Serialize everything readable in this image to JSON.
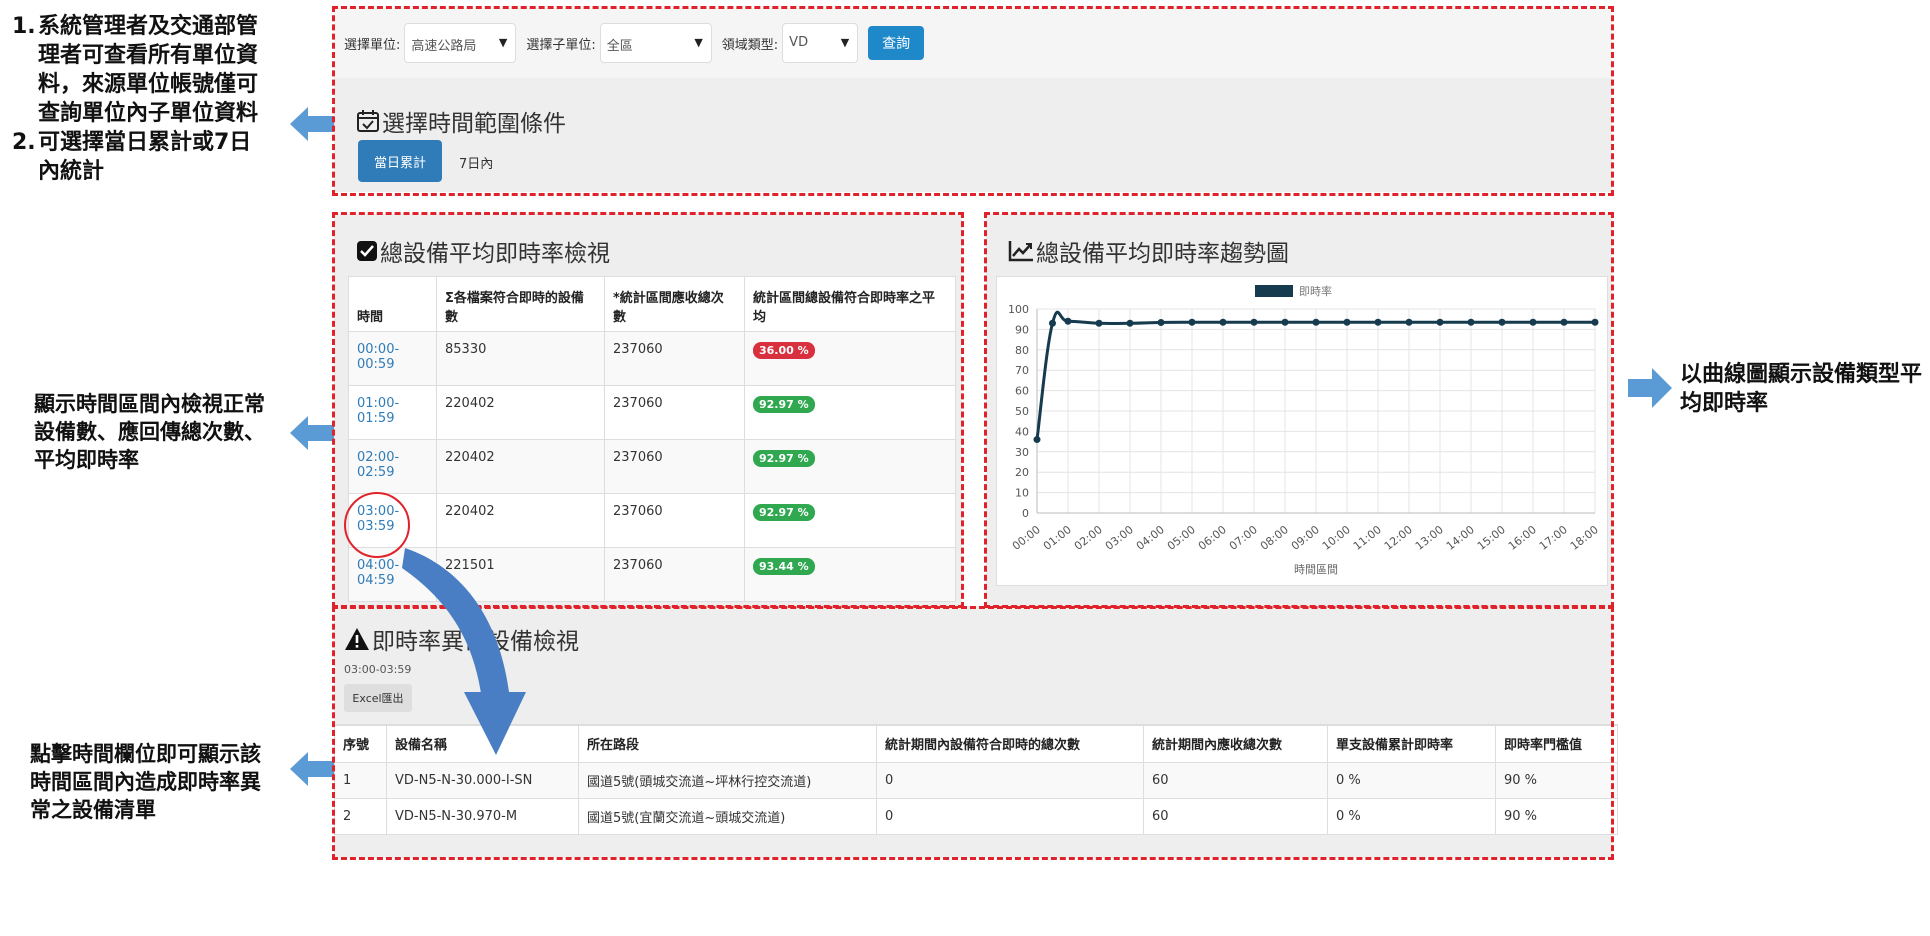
{
  "filters": {
    "unit_label": "選擇單位:",
    "unit_value": "高速公路局",
    "subunit_label": "選擇子單位:",
    "subunit_value": "全區",
    "domain_label": "領域類型:",
    "domain_value": "VD",
    "query_label": "查詢"
  },
  "time_range": {
    "title": "選擇時間範圍條件",
    "tab_today": "當日累計",
    "tab_7days": "7日內"
  },
  "summary": {
    "title": "總設備平均即時率檢視",
    "columns": [
      "時間",
      "Σ各檔案符合即時的設備數",
      "*統計區間應收總次數",
      "統計區間總設備符合即時率之平均"
    ],
    "rows": [
      {
        "time": "00:00-00:59",
        "devices": "85330",
        "total": "237060",
        "rate": "36.00 %",
        "status": "bad"
      },
      {
        "time": "01:00-01:59",
        "devices": "220402",
        "total": "237060",
        "rate": "92.97 %",
        "status": "good"
      },
      {
        "time": "02:00-02:59",
        "devices": "220402",
        "total": "237060",
        "rate": "92.97 %",
        "status": "good"
      },
      {
        "time": "03:00-03:59",
        "devices": "220402",
        "total": "237060",
        "rate": "92.97 %",
        "status": "good"
      },
      {
        "time": "04:00-04:59",
        "devices": "221501",
        "total": "237060",
        "rate": "93.44 %",
        "status": "good"
      }
    ]
  },
  "trend": {
    "title": "總設備平均即時率趨勢圖"
  },
  "chart_data": {
    "type": "line",
    "legend": "即時率",
    "legend_position": "top",
    "xlabel": "時間區間",
    "categories": [
      "00:00",
      "01:00",
      "02:00",
      "03:00",
      "04:00",
      "05:00",
      "06:00",
      "07:00",
      "08:00",
      "09:00",
      "10:00",
      "11:00",
      "12:00",
      "13:00",
      "14:00",
      "15:00",
      "16:00",
      "17:00",
      "18:00"
    ],
    "x": [
      0,
      0.5,
      1,
      2,
      3,
      4,
      5,
      6,
      7,
      8,
      9,
      10,
      11,
      12,
      13,
      14,
      15,
      16,
      17,
      18
    ],
    "values": [
      36,
      93,
      94,
      93,
      93,
      93.4,
      93.5,
      93.5,
      93.5,
      93.5,
      93.5,
      93.5,
      93.5,
      93.5,
      93.5,
      93.5,
      93.5,
      93.5,
      93.5,
      93.5
    ],
    "ylim": [
      0,
      100
    ],
    "yticks": [
      0,
      10,
      20,
      30,
      40,
      50,
      60,
      70,
      80,
      90,
      100
    ],
    "grid": true,
    "colors": {
      "line": "#163a4e",
      "legend_box": "#163a4e"
    }
  },
  "abnormal": {
    "title": "即時率異常設備檢視",
    "range": "03:00-03:59",
    "export_label": "Excel匯出",
    "columns": [
      "序號",
      "設備名稱",
      "所在路段",
      "統計期間內設備符合即時的總次數",
      "統計期間內應收總次數",
      "單支設備累計即時率",
      "即時率門檻值"
    ],
    "rows": [
      [
        "1",
        "VD-N5-N-30.000-I-SN",
        "國道5號(頭城交流道~坪林行控交流道)",
        "0",
        "60",
        "0 %",
        "90 %"
      ],
      [
        "2",
        "VD-N5-N-30.970-M",
        "國道5號(宜蘭交流道~頭城交流道)",
        "0",
        "60",
        "0 %",
        "90 %"
      ]
    ]
  },
  "notes": {
    "n1_num": "1.",
    "n1_text": "系統管理者及交通部管理者可查看所有單位資料，來源單位帳號僅可查詢單位內子單位資料",
    "n2_num": "2.",
    "n2_text": "可選擇當日累計或7日內統計",
    "mid_left": "顯示時間區間內檢視正常設備數、應回傳總次數、平均即時率",
    "bottom_left": "點擊時間欄位即可顯示該時間區間內造成即時率異常之設備清單",
    "right": "以曲線圖顯示設備類型平均即時率"
  },
  "colors": {
    "frame_red": "#e0232a",
    "arrow_blue": "#5b9bd5",
    "badge_red": "#d9303f",
    "badge_green": "#2fa84f",
    "link_blue": "#2f7cb8"
  }
}
